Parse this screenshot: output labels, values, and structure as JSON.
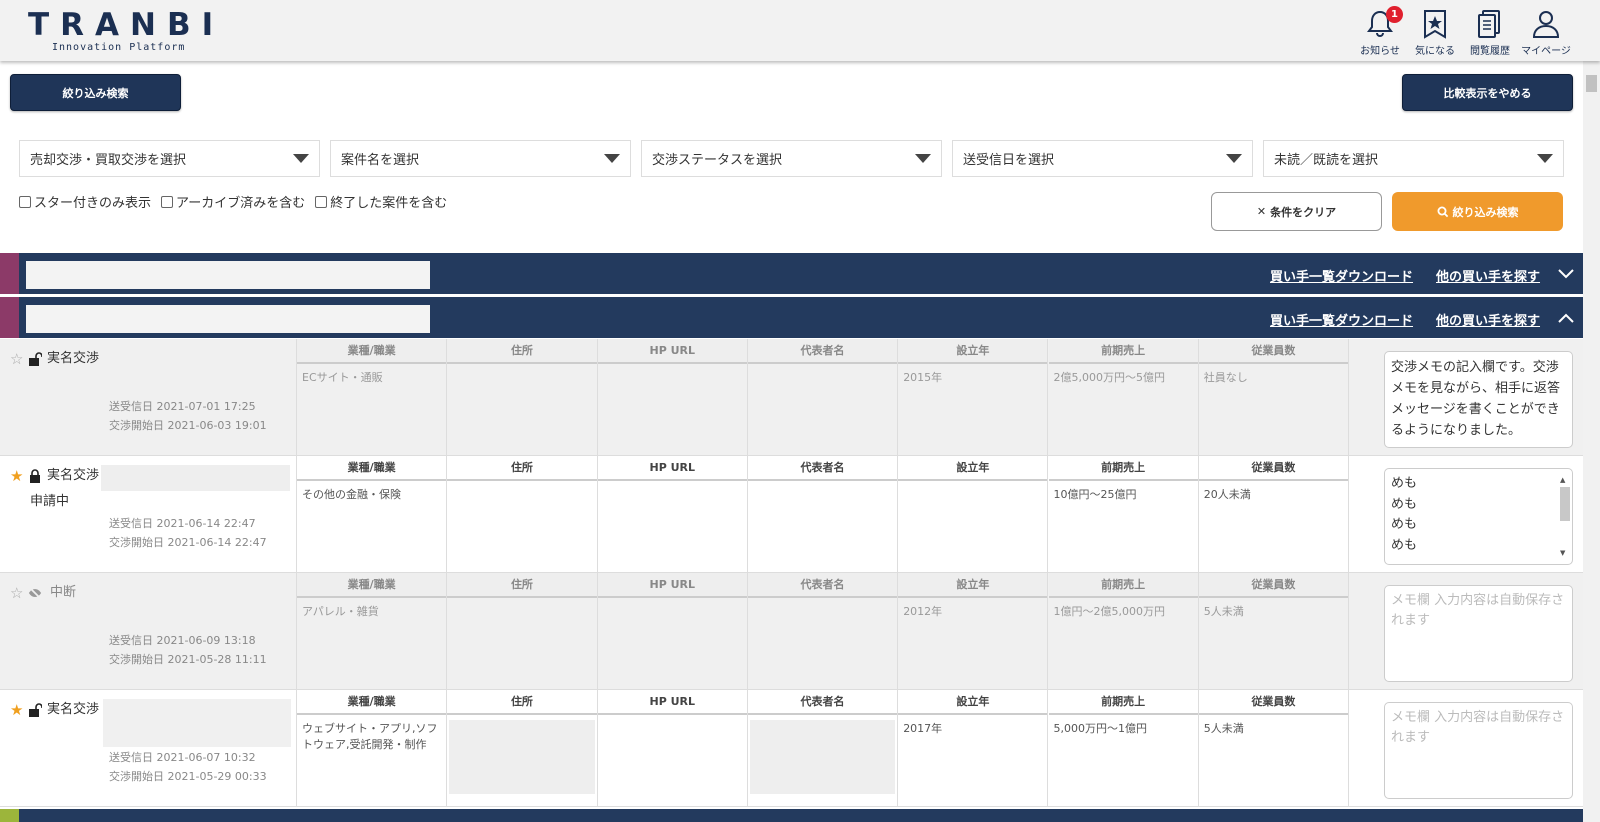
{
  "header": {
    "logo": "TRANBI",
    "logo_sub": "Innovation Platform",
    "nav": [
      {
        "label": "お知らせ",
        "icon": "bell-icon",
        "badge": "1"
      },
      {
        "label": "気になる",
        "icon": "bookmark-star-icon"
      },
      {
        "label": "閲覧履歴",
        "icon": "history-doc-icon"
      },
      {
        "label": "マイページ",
        "icon": "user-icon"
      }
    ]
  },
  "toolbar": {
    "filter_button": "絞り込み検索",
    "compare_button": "比較表示をやめる"
  },
  "filters": {
    "selects": [
      "売却交渉・買取交渉を選択",
      "案件名を選択",
      "交渉ステータスを選択",
      "送受信日を選択",
      "未読／既読を選択"
    ],
    "checkboxes": [
      "スター付きのみ表示",
      "アーカイブ済みを含む",
      "終了した案件を含む"
    ],
    "clear_button": "条件をクリア",
    "search_button": "絞り込み検索"
  },
  "group": {
    "download_link": "買い手一覧ダウンロード",
    "find_link": "他の買い手を探す"
  },
  "columns": [
    "業種/職業",
    "住所",
    "HP URL",
    "代表者名",
    "設立年",
    "前期売上",
    "従業員数"
  ],
  "rows": [
    {
      "starred": false,
      "status": "実名交渉",
      "status2": "",
      "sent_label": "送受信日 2021-07-01 17:25",
      "start_label": "交渉開始日 2021-06-03 19:01",
      "cells": [
        "ECサイト・通販",
        "",
        "",
        "",
        "2015年",
        "2億5,000万円〜5億円",
        "社員なし"
      ],
      "memo": "交渉メモの記入欄です。交渉メモを見ながら、相手に返答メッセージを書くことができるようになりました。",
      "memo_placeholder": ""
    },
    {
      "starred": true,
      "status": "実名交渉",
      "status2": "申請中",
      "sent_label": "送受信日 2021-06-14 22:47",
      "start_label": "交渉開始日 2021-06-14 22:47",
      "cells": [
        "その他の金融・保険",
        "",
        "",
        "",
        "",
        "10億円〜25億円",
        "20人未満"
      ],
      "memo_lines": [
        "めも",
        "めも",
        "めも",
        "めも"
      ]
    },
    {
      "starred": false,
      "status": "中断",
      "status2": "",
      "sent_label": "送受信日 2021-06-09 13:18",
      "start_label": "交渉開始日 2021-05-28 11:11",
      "cells": [
        "アパレル・雑貨",
        "",
        "",
        "",
        "2012年",
        "1億円〜2億5,000万円",
        "5人未満"
      ],
      "memo": "",
      "memo_placeholder": "メモ欄 入力内容は自動保存されます"
    },
    {
      "starred": true,
      "status": "実名交渉",
      "status2": "",
      "sent_label": "送受信日 2021-06-07 10:32",
      "start_label": "交渉開始日 2021-05-29 00:33",
      "cells": [
        "ウェブサイト・アプリ,ソフトウェア,受託開発・制作",
        "",
        "",
        "",
        "2017年",
        "5,000万円〜1億円",
        "5人未満"
      ],
      "memo": "",
      "memo_placeholder": "メモ欄 入力内容は自動保存されます"
    }
  ],
  "colors": {
    "navy": "#233a5e",
    "orange": "#f09a2c",
    "accent_purple": "#8c3a68",
    "accent_green": "#9cb53b",
    "star": "#f0a020"
  }
}
